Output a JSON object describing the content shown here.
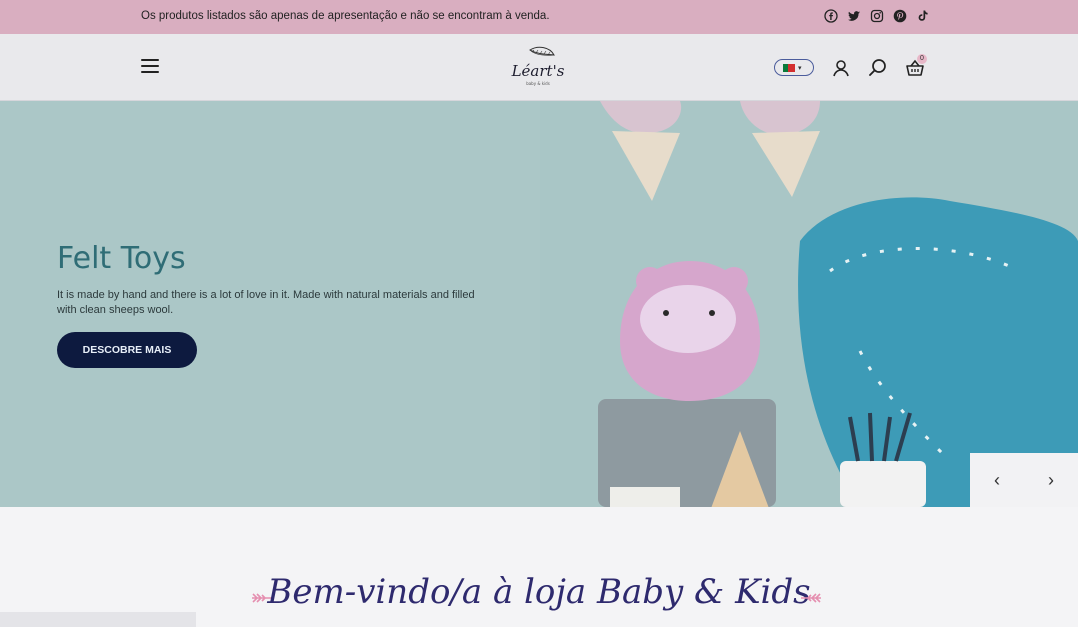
{
  "topbar": {
    "notice": "Os produtos listados são apenas de apresentação e não se encontram à venda.",
    "social_icons": [
      "facebook-icon",
      "twitter-icon",
      "instagram-icon",
      "pinterest-icon",
      "tiktok-icon"
    ]
  },
  "header": {
    "logo_alt": "Léart's",
    "language": "PT",
    "cart_count": "0",
    "icons": [
      "menu-icon",
      "user-icon",
      "search-icon",
      "basket-icon"
    ]
  },
  "hero": {
    "title": "Felt Toys",
    "text": "It is made by hand and there is a lot of love in it. Made with natural materials and filled with clean sheeps wool.",
    "button_label": "DESCOBRE MAIS",
    "prev_label": "‹",
    "next_label": "›"
  },
  "welcome": {
    "title": "Bem-vindo/a à loja Baby & Kids"
  },
  "colors": {
    "topbar": "#d9aec0",
    "header": "#e9e9ec",
    "hero_bg": "#a8c4c5",
    "hero_title": "#2f6d76",
    "button": "#0d1a3f",
    "welcome_title": "#2e2a6e",
    "leaf": "#e58fb0"
  }
}
